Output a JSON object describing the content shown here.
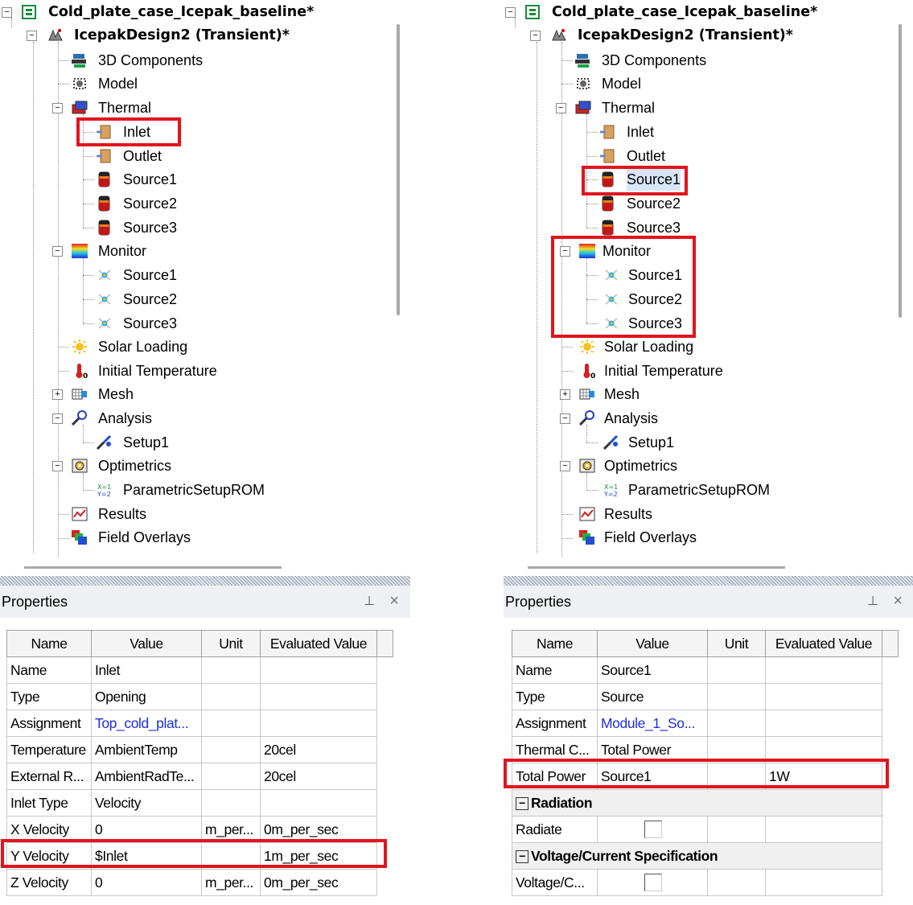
{
  "left": {
    "tree": {
      "project": "Cold_plate_case_Icepak_baseline*",
      "design": "IcepakDesign2 (Transient)*",
      "items": {
        "components": "3D Components",
        "model": "Model",
        "thermal": "Thermal",
        "inlet": "Inlet",
        "outlet": "Outlet",
        "source1": "Source1",
        "source2": "Source2",
        "source3": "Source3",
        "monitor": "Monitor",
        "mon_source1": "Source1",
        "mon_source2": "Source2",
        "mon_source3": "Source3",
        "solar": "Solar Loading",
        "initial_temp": "Initial Temperature",
        "mesh": "Mesh",
        "analysis": "Analysis",
        "setup1": "Setup1",
        "optimetrics": "Optimetrics",
        "parametric": "ParametricSetupROM",
        "results": "Results",
        "field_overlays": "Field Overlays"
      }
    },
    "properties": {
      "title": "Properties",
      "columns": [
        "Name",
        "Value",
        "Unit",
        "Evaluated Value"
      ],
      "rows": [
        {
          "name": "Name",
          "value": "Inlet",
          "unit": "",
          "evaluated": ""
        },
        {
          "name": "Type",
          "value": "Opening",
          "unit": "",
          "evaluated": ""
        },
        {
          "name": "Assignment",
          "value": "Top_cold_plat...",
          "unit": "",
          "evaluated": ""
        },
        {
          "name": "Temperature",
          "value": "AmbientTemp",
          "unit": "",
          "evaluated": "20cel"
        },
        {
          "name": "External R...",
          "value": "AmbientRadTe...",
          "unit": "",
          "evaluated": "20cel"
        },
        {
          "name": "Inlet Type",
          "value": "Velocity",
          "unit": "",
          "evaluated": ""
        },
        {
          "name": "X Velocity",
          "value": "0",
          "unit": "m_per...",
          "evaluated": "0m_per_sec"
        },
        {
          "name": "Y Velocity",
          "value": "$Inlet",
          "unit": "",
          "evaluated": "1m_per_sec"
        },
        {
          "name": "Z Velocity",
          "value": "0",
          "unit": "m_per...",
          "evaluated": "0m_per_sec"
        }
      ]
    }
  },
  "right": {
    "tree": {
      "project": "Cold_plate_case_Icepak_baseline*",
      "design": "IcepakDesign2 (Transient)*",
      "items": {
        "components": "3D Components",
        "model": "Model",
        "thermal": "Thermal",
        "inlet": "Inlet",
        "outlet": "Outlet",
        "source1": "Source1",
        "source2": "Source2",
        "source3": "Source3",
        "monitor": "Monitor",
        "mon_source1": "Source1",
        "mon_source2": "Source2",
        "mon_source3": "Source3",
        "solar": "Solar Loading",
        "initial_temp": "Initial Temperature",
        "mesh": "Mesh",
        "analysis": "Analysis",
        "setup1": "Setup1",
        "optimetrics": "Optimetrics",
        "parametric": "ParametricSetupROM",
        "results": "Results",
        "field_overlays": "Field Overlays"
      }
    },
    "properties": {
      "title": "Properties",
      "columns": [
        "Name",
        "Value",
        "Unit",
        "Evaluated Value"
      ],
      "rows": [
        {
          "name": "Name",
          "value": "Source1",
          "unit": "",
          "evaluated": ""
        },
        {
          "name": "Type",
          "value": "Source",
          "unit": "",
          "evaluated": ""
        },
        {
          "name": "Assignment",
          "value": "Module_1_So...",
          "unit": "",
          "evaluated": ""
        },
        {
          "name": "Thermal C...",
          "value": "Total Power",
          "unit": "",
          "evaluated": ""
        },
        {
          "name": "Total Power",
          "value": "Source1",
          "unit": "",
          "evaluated": "1W"
        }
      ],
      "section_radiation": "Radiation",
      "radiate_label": "Radiate",
      "section_voltage": "Voltage/Current Specification",
      "voltage_label": "Voltage/C..."
    }
  },
  "colors": {
    "highlight": "#e0141e",
    "link": "#1d2fd6"
  }
}
